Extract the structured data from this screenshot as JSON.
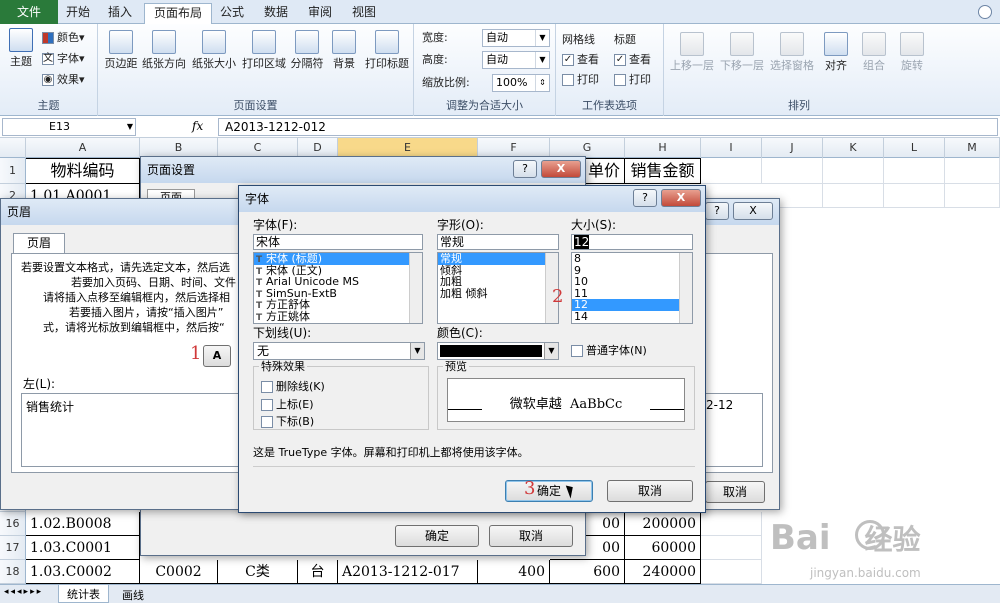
{
  "ribbon": {
    "tabs": [
      "文件",
      "开始",
      "插入",
      "页面布局",
      "公式",
      "数据",
      "审阅",
      "视图"
    ],
    "theme": {
      "main": "主题",
      "colors": "颜色",
      "fonts": "字体",
      "effects": "效果",
      "label": "主题"
    },
    "page_setup": {
      "margins": "页边距",
      "orientation": "纸张方向",
      "size": "纸张大小",
      "print_area": "打印区域",
      "breaks": "分隔符",
      "background": "背景",
      "print_titles": "打印标题",
      "label": "页面设置"
    },
    "scale": {
      "width_label": "宽度:",
      "width_value": "自动",
      "height_label": "高度:",
      "height_value": "自动",
      "zoom_label": "缩放比例:",
      "zoom_value": "100%",
      "label": "调整为合适大小"
    },
    "sheet_options": {
      "gridlines": "网格线",
      "headings": "标题",
      "view1": "查看",
      "view2": "查看",
      "print1": "打印",
      "print2": "打印",
      "label": "工作表选项"
    },
    "arrange": {
      "bring_forward": "上移一层",
      "send_backward": "下移一层",
      "selection_pane": "选择窗格",
      "align": "对齐",
      "group": "组合",
      "rotate": "旋转",
      "label": "排列"
    }
  },
  "formula_bar": {
    "name_box": "E13",
    "fx": "fx",
    "formula": "A2013-1212-012"
  },
  "grid": {
    "columns": [
      "A",
      "B",
      "C",
      "D",
      "E",
      "F",
      "G",
      "H",
      "I",
      "J",
      "K",
      "L",
      "M"
    ],
    "rows_top": [
      {
        "num": "1",
        "a": "物料编码",
        "g": "单价",
        "h": "销售金额"
      },
      {
        "num": "2",
        "a": "1.01.A0001"
      }
    ],
    "rows_bottom": [
      {
        "num": "16",
        "a": "1.02.B0008",
        "f": "00",
        "h": "200000"
      },
      {
        "num": "17",
        "a": "1.03.C0001",
        "f": "00",
        "h": "60000"
      },
      {
        "num": "18",
        "a": "1.03.C0002",
        "b": "C0002",
        "c": "C类",
        "d": "台",
        "e": "A2013-1212-017",
        "f": "400",
        "g": "600",
        "h": "240000"
      }
    ],
    "sheet_tabs": [
      "统计表",
      "画线"
    ]
  },
  "page_setup_dialog": {
    "title": "页面设置",
    "tab": "页面",
    "ok": "确定",
    "cancel": "取消",
    "help": "?",
    "close": "X"
  },
  "header_dialog": {
    "title": "页眉",
    "tab": "页眉",
    "instructions": [
      "若要设置文本格式，请先选定文本，然后选",
      "若要加入页码、日期、时间、文件",
      "请将插入点移至编辑框内，然后选择相",
      "若要插入图片，请按“插入图片”",
      "式，请将光标放到编辑框中，然后按“"
    ],
    "font_button": "A",
    "left_label": "左(L):",
    "left_value": "销售统计",
    "right_partial": "2-12",
    "cancel": "取消",
    "help": "?",
    "close": "X"
  },
  "font_dialog": {
    "title": "字体",
    "help": "?",
    "close": "X",
    "font_label": "字体(F):",
    "font_value": "宋体",
    "fonts": [
      "宋体 (标题)",
      "宋体 (正文)",
      "Arial Unicode MS",
      "SimSun-ExtB",
      "方正舒体",
      "方正姚体"
    ],
    "style_label": "字形(O):",
    "style_value": "常规",
    "styles": [
      "常规",
      "倾斜",
      "加粗",
      "加粗 倾斜"
    ],
    "size_label": "大小(S):",
    "size_value": "12",
    "sizes": [
      "8",
      "9",
      "10",
      "11",
      "12",
      "14"
    ],
    "underline_label": "下划线(U):",
    "underline_value": "无",
    "color_label": "颜色(C):",
    "color_value": "#000000",
    "normal_font": "普通字体(N)",
    "effects_label": "特殊效果",
    "effects": [
      "删除线(K)",
      "上标(E)",
      "下标(B)"
    ],
    "preview_label": "预览",
    "preview_text": "微软卓越  AaBbCc",
    "info": "这是 TrueType 字体。屏幕和打印机上都将使用该字体。",
    "ok": "确定",
    "cancel": "取消"
  },
  "annotations": [
    "1",
    "2",
    "3"
  ],
  "watermark": {
    "brand": "Bai",
    "brand2": "经验",
    "url": "jingyan.baidu.com"
  }
}
